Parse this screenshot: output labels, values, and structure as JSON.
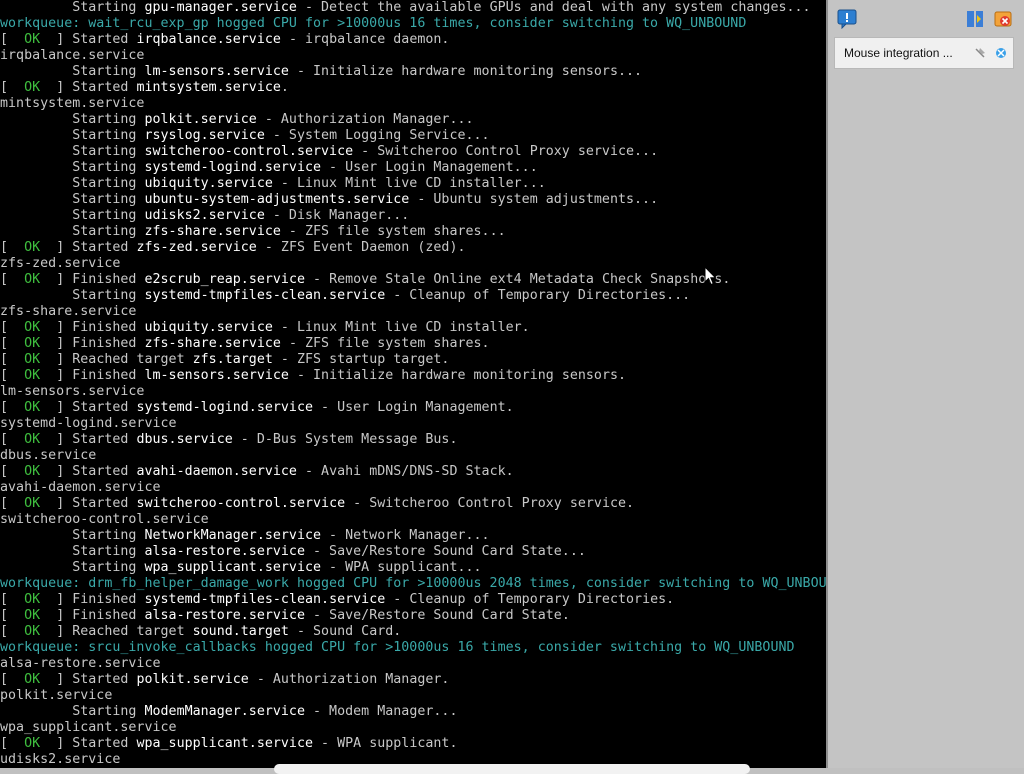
{
  "console": {
    "lines": [
      {
        "kind": "plain",
        "pre": "         Starting ",
        "unit": "gpu-manager.service",
        "post": " - Detect the available GPUs and deal with any system changes..."
      },
      {
        "kind": "wq",
        "text": "workqueue: wait_rcu_exp_gp hogged CPU for >10000us 16 times, consider switching to WQ_UNBOUND"
      },
      {
        "kind": "ok",
        "pre": " Started ",
        "unit": "irqbalance.service",
        "post": " - irqbalance daemon."
      },
      {
        "kind": "plain",
        "pre": "irqbalance.service",
        "unit": "",
        "post": ""
      },
      {
        "kind": "plain",
        "pre": "         Starting ",
        "unit": "lm-sensors.service",
        "post": " - Initialize hardware monitoring sensors..."
      },
      {
        "kind": "ok",
        "pre": " Started ",
        "unit": "mintsystem.service",
        "post": "."
      },
      {
        "kind": "plain",
        "pre": "mintsystem.service",
        "unit": "",
        "post": ""
      },
      {
        "kind": "plain",
        "pre": "         Starting ",
        "unit": "polkit.service",
        "post": " - Authorization Manager..."
      },
      {
        "kind": "plain",
        "pre": "         Starting ",
        "unit": "rsyslog.service",
        "post": " - System Logging Service..."
      },
      {
        "kind": "plain",
        "pre": "         Starting ",
        "unit": "switcheroo-control.service",
        "post": " - Switcheroo Control Proxy service..."
      },
      {
        "kind": "plain",
        "pre": "         Starting ",
        "unit": "systemd-logind.service",
        "post": " - User Login Management..."
      },
      {
        "kind": "plain",
        "pre": "         Starting ",
        "unit": "ubiquity.service",
        "post": " - Linux Mint live CD installer..."
      },
      {
        "kind": "plain",
        "pre": "         Starting ",
        "unit": "ubuntu-system-adjustments.service",
        "post": " - Ubuntu system adjustments..."
      },
      {
        "kind": "plain",
        "pre": "         Starting ",
        "unit": "udisks2.service",
        "post": " - Disk Manager..."
      },
      {
        "kind": "plain",
        "pre": "         Starting ",
        "unit": "zfs-share.service",
        "post": " - ZFS file system shares..."
      },
      {
        "kind": "ok",
        "pre": " Started ",
        "unit": "zfs-zed.service",
        "post": " - ZFS Event Daemon (zed)."
      },
      {
        "kind": "plain",
        "pre": "zfs-zed.service",
        "unit": "",
        "post": ""
      },
      {
        "kind": "ok",
        "pre": " Finished ",
        "unit": "e2scrub_reap.service",
        "post": " - Remove Stale Online ext4 Metadata Check Snapshots."
      },
      {
        "kind": "plain",
        "pre": "         Starting ",
        "unit": "systemd-tmpfiles-clean.service",
        "post": " - Cleanup of Temporary Directories..."
      },
      {
        "kind": "plain",
        "pre": "zfs-share.service",
        "unit": "",
        "post": ""
      },
      {
        "kind": "ok",
        "pre": " Finished ",
        "unit": "ubiquity.service",
        "post": " - Linux Mint live CD installer."
      },
      {
        "kind": "ok",
        "pre": " Finished ",
        "unit": "zfs-share.service",
        "post": " - ZFS file system shares."
      },
      {
        "kind": "ok",
        "pre": " Reached target ",
        "unit": "zfs.target",
        "post": " - ZFS startup target."
      },
      {
        "kind": "ok",
        "pre": " Finished ",
        "unit": "lm-sensors.service",
        "post": " - Initialize hardware monitoring sensors."
      },
      {
        "kind": "plain",
        "pre": "lm-sensors.service",
        "unit": "",
        "post": ""
      },
      {
        "kind": "ok",
        "pre": " Started ",
        "unit": "systemd-logind.service",
        "post": " - User Login Management."
      },
      {
        "kind": "plain",
        "pre": "systemd-logind.service",
        "unit": "",
        "post": ""
      },
      {
        "kind": "ok",
        "pre": " Started ",
        "unit": "dbus.service",
        "post": " - D-Bus System Message Bus."
      },
      {
        "kind": "plain",
        "pre": "dbus.service",
        "unit": "",
        "post": ""
      },
      {
        "kind": "ok",
        "pre": " Started ",
        "unit": "avahi-daemon.service",
        "post": " - Avahi mDNS/DNS-SD Stack."
      },
      {
        "kind": "plain",
        "pre": "avahi-daemon.service",
        "unit": "",
        "post": ""
      },
      {
        "kind": "ok",
        "pre": " Started ",
        "unit": "switcheroo-control.service",
        "post": " - Switcheroo Control Proxy service."
      },
      {
        "kind": "plain",
        "pre": "switcheroo-control.service",
        "unit": "",
        "post": ""
      },
      {
        "kind": "plain",
        "pre": "         Starting ",
        "unit": "NetworkManager.service",
        "post": " - Network Manager..."
      },
      {
        "kind": "plain",
        "pre": "         Starting ",
        "unit": "alsa-restore.service",
        "post": " - Save/Restore Sound Card State..."
      },
      {
        "kind": "plain",
        "pre": "         Starting ",
        "unit": "wpa_supplicant.service",
        "post": " - WPA supplicant..."
      },
      {
        "kind": "wq",
        "text": "workqueue: drm_fb_helper_damage_work hogged CPU for >10000us 2048 times, consider switching to WQ_UNBOUND"
      },
      {
        "kind": "ok",
        "pre": " Finished ",
        "unit": "systemd-tmpfiles-clean.service",
        "post": " - Cleanup of Temporary Directories."
      },
      {
        "kind": "ok",
        "pre": " Finished ",
        "unit": "alsa-restore.service",
        "post": " - Save/Restore Sound Card State."
      },
      {
        "kind": "ok",
        "pre": " Reached target ",
        "unit": "sound.target",
        "post": " - Sound Card."
      },
      {
        "kind": "wq",
        "text": "workqueue: srcu_invoke_callbacks hogged CPU for >10000us 16 times, consider switching to WQ_UNBOUND"
      },
      {
        "kind": "plain",
        "pre": "alsa-restore.service",
        "unit": "",
        "post": ""
      },
      {
        "kind": "ok",
        "pre": " Started ",
        "unit": "polkit.service",
        "post": " - Authorization Manager."
      },
      {
        "kind": "plain",
        "pre": "polkit.service",
        "unit": "",
        "post": ""
      },
      {
        "kind": "plain",
        "pre": "         Starting ",
        "unit": "ModemManager.service",
        "post": " - Modem Manager..."
      },
      {
        "kind": "plain",
        "pre": "wpa_supplicant.service",
        "unit": "",
        "post": ""
      },
      {
        "kind": "ok",
        "pre": " Started ",
        "unit": "wpa_supplicant.service",
        "post": " - WPA supplicant."
      },
      {
        "kind": "plain",
        "pre": "udisks2.service",
        "unit": "",
        "post": ""
      }
    ],
    "ok_label": "OK",
    "colors": {
      "background": "#000000",
      "text": "#c8c8c8",
      "ok": "#3fbf3f",
      "unit": "#ffffff",
      "workqueue": "#3aa9a9"
    }
  },
  "sidebar": {
    "notification": {
      "text": "Mouse integration ..."
    },
    "icons": [
      "message-icon",
      "display-settings-icon",
      "close-panel-icon",
      "pin-icon",
      "mouse-integration-icon"
    ]
  }
}
